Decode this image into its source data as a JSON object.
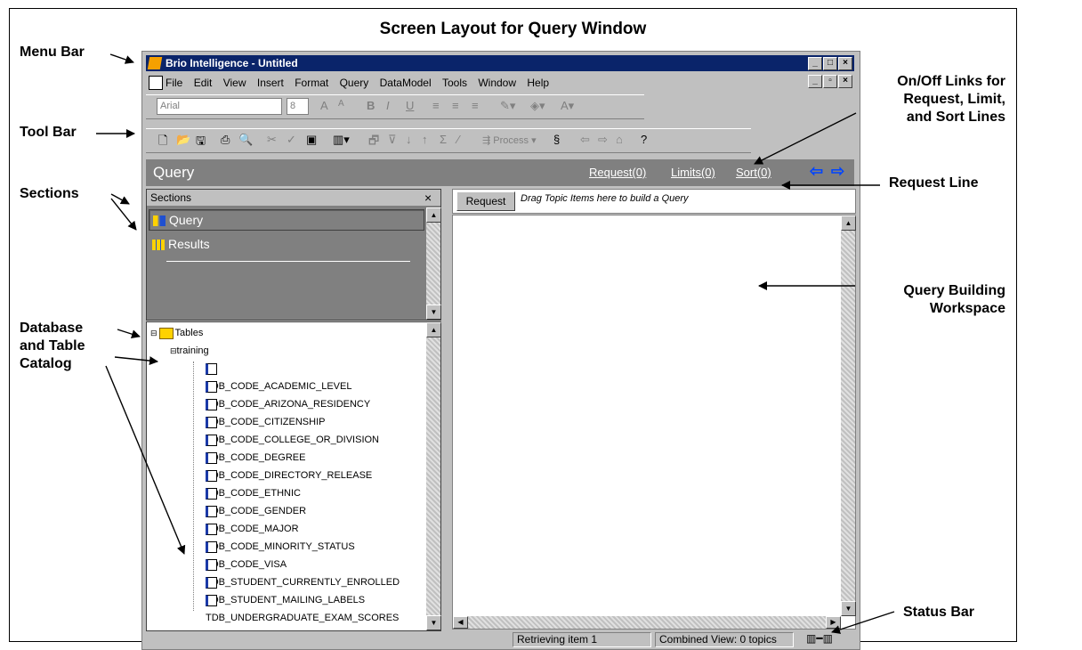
{
  "diagram": {
    "title": "Screen Layout for Query Window",
    "labels": {
      "menu_bar": "Menu Bar",
      "tool_bar": "Tool Bar",
      "sections": "Sections",
      "database_catalog": [
        "Database",
        "and Table",
        "Catalog"
      ],
      "onoff_links": [
        "On/Off Links for",
        "Request, Limit,",
        "and Sort Lines"
      ],
      "request_line": "Request Line",
      "query_workspace": [
        "Query Building",
        "Workspace"
      ],
      "status_bar": "Status Bar"
    }
  },
  "window": {
    "title": "Brio Intelligence - Untitled",
    "menu": [
      "File",
      "Edit",
      "View",
      "Insert",
      "Format",
      "Query",
      "DataModel",
      "Tools",
      "Window",
      "Help"
    ],
    "font_name": "Arial",
    "font_size": "8",
    "process_label": "Process"
  },
  "query_header": {
    "title": "Query",
    "links": [
      "Request(0)",
      "Limits(0)",
      "Sort(0)"
    ]
  },
  "sections": {
    "header": "Sections",
    "close": "×",
    "items": [
      "Query",
      "Results"
    ]
  },
  "catalog": {
    "root": "Tables",
    "database": "training",
    "tables": [
      "TDB_CODE_ACADEMIC_LEVEL",
      "TDB_CODE_ARIZONA_RESIDENCY",
      "TDB_CODE_CITIZENSHIP",
      "TDB_CODE_COLLEGE_OR_DIVISION",
      "TDB_CODE_DEGREE",
      "TDB_CODE_DIRECTORY_RELEASE",
      "TDB_CODE_ETHNIC",
      "TDB_CODE_GENDER",
      "TDB_CODE_MAJOR",
      "TDB_CODE_MINORITY_STATUS",
      "TDB_CODE_VISA",
      "TDB_STUDENT_CURRENTLY_ENROLLED",
      "TDB_STUDENT_MAILING_LABELS",
      "TDB_UNDERGRADUATE_EXAM_SCORES"
    ]
  },
  "request_line": {
    "button": "Request",
    "hint": "Drag Topic Items here to build a Query"
  },
  "status": {
    "message": "Retrieving item 1",
    "view": "Combined View: 0 topics"
  }
}
